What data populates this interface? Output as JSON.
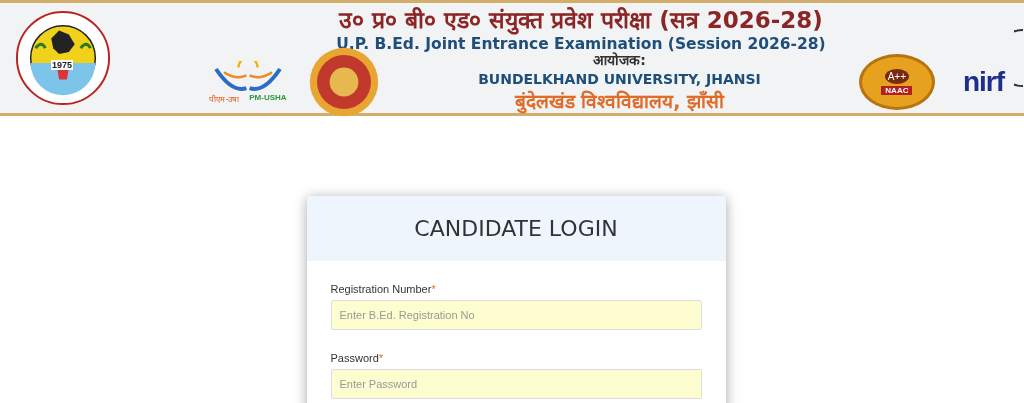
{
  "banner": {
    "title_hindi": "उ० प्र० बी० एड० संयुक्त प्रवेश परीक्षा (सत्र 2026-28)",
    "title_english": "U.P. B.Ed. Joint Entrance Examination (Session 2026-28)",
    "organiser_label": "आयोजक:",
    "university_english": "BUNDELKHAND UNIVERSITY, JHANSI",
    "university_hindi": "बुंदेलखंड विश्वविद्यालय, झाँसी",
    "seal_year": "1975",
    "pm_usha_hindi": "पीएम-उषा",
    "pm_usha_english": "PM-USHA",
    "naac_grade": "A++",
    "naac_label": "NAAC",
    "nirf_label": "nirf"
  },
  "login": {
    "title": "CANDIDATE LOGIN",
    "fields": [
      {
        "label": "Registration Number",
        "required_mark": "*",
        "placeholder": "Enter B.Ed. Registration No"
      },
      {
        "label": "Password",
        "required_mark": "*",
        "placeholder": "Enter Password"
      }
    ]
  }
}
